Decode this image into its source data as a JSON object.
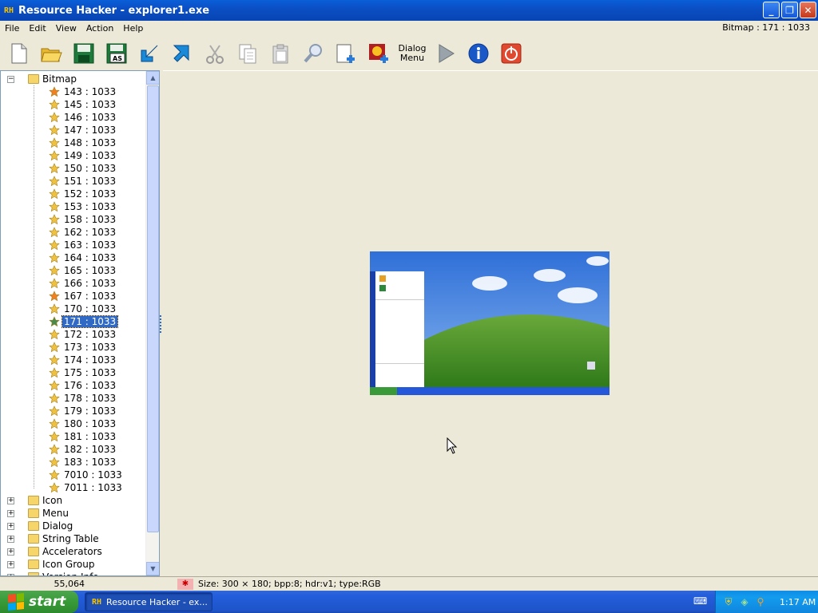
{
  "window": {
    "title": "Resource Hacker - explorer1.exe",
    "app_icon_text": "RH",
    "minimize_glyph": "_",
    "restore_glyph": "❐",
    "close_glyph": "✕"
  },
  "menubar": {
    "items": [
      "File",
      "Edit",
      "View",
      "Action",
      "Help"
    ],
    "status": "Bitmap : 171 : 1033"
  },
  "toolbar": {
    "dialog_menu_line1": "Dialog",
    "dialog_menu_line2": "Menu",
    "icons": [
      "new-file-icon",
      "open-folder-icon",
      "save-icon",
      "save-as-icon",
      "import-arrow-icon",
      "export-arrow-icon",
      "cut-icon",
      "copy-icon",
      "paste-icon",
      "find-icon",
      "add-resource-icon",
      "add-image-icon",
      "dialog-menu-icon",
      "run-icon",
      "info-icon",
      "exit-icon"
    ],
    "save_as_label": "AS"
  },
  "tree": {
    "root": {
      "label": "Bitmap",
      "expander": "−"
    },
    "children": [
      "143 : 1033",
      "145 : 1033",
      "146 : 1033",
      "147 : 1033",
      "148 : 1033",
      "149 : 1033",
      "150 : 1033",
      "151 : 1033",
      "152 : 1033",
      "153 : 1033",
      "158 : 1033",
      "162 : 1033",
      "163 : 1033",
      "164 : 1033",
      "165 : 1033",
      "166 : 1033",
      "167 : 1033",
      "170 : 1033",
      "171 : 1033",
      "172 : 1033",
      "173 : 1033",
      "174 : 1033",
      "175 : 1033",
      "176 : 1033",
      "178 : 1033",
      "179 : 1033",
      "180 : 1033",
      "181 : 1033",
      "182 : 1033",
      "183 : 1033",
      "7010 : 1033",
      "7011 : 1033"
    ],
    "selected": "171 : 1033",
    "highlighted_children": [
      "143 : 1033",
      "167 : 1033"
    ],
    "folders": [
      "Icon",
      "Menu",
      "Dialog",
      "String Table",
      "Accelerators",
      "Icon Group",
      "Version Info"
    ],
    "collapsed_expander": "+"
  },
  "statusbar": {
    "count": "55,064",
    "icon_glyph": "✱",
    "info": "Size: 300 × 180;  bpp:8;  hdr:v1;  type:RGB"
  },
  "taskbar": {
    "start_label": "start",
    "task_label": "Resource Hacker - ex...",
    "task_icon": "RH",
    "clock": "1:17 AM"
  },
  "colors": {
    "titlebar": "#0a5fd8",
    "selection": "#316ac5",
    "star": "#f0c040",
    "star_orange": "#f08020",
    "star_selected": "#4a8a4a"
  }
}
